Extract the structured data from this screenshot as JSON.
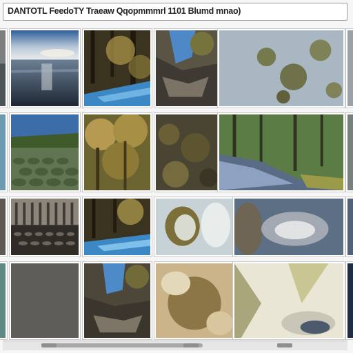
{
  "window": {
    "title": "DANTOTL FeedoTY Traeaw Qqopmmmrl 1101 Blumd mnao)"
  },
  "gallery": {
    "rows": [
      {
        "items": [
          {
            "name": "photo-rocky-shore",
            "kind": "rocks"
          },
          {
            "name": "photo-ocean-sunset",
            "kind": "ocean"
          },
          {
            "name": "photo-forest-stream",
            "kind": "forest-stream"
          },
          {
            "name": "photo-cliff-waterfall",
            "kind": "cliff"
          },
          {
            "name": "photo-lichen-stone",
            "kind": "lichen"
          },
          {
            "name": "photo-edge-right",
            "kind": "edge"
          }
        ]
      },
      {
        "items": [
          {
            "name": "photo-blue-edge",
            "kind": "edge"
          },
          {
            "name": "photo-terraced-hills",
            "kind": "terraces"
          },
          {
            "name": "photo-autumn-woods",
            "kind": "autumn"
          },
          {
            "name": "photo-mossy-ground",
            "kind": "moss"
          },
          {
            "name": "photo-forest-river",
            "kind": "forest-river"
          },
          {
            "name": "photo-edge-right-2",
            "kind": "edge"
          }
        ]
      },
      {
        "items": [
          {
            "name": "photo-dark-edge",
            "kind": "edge"
          },
          {
            "name": "photo-stone-columns",
            "kind": "columns"
          },
          {
            "name": "photo-forest-stream-2",
            "kind": "forest-stream"
          },
          {
            "name": "photo-ice-crystals",
            "kind": "ice"
          },
          {
            "name": "photo-blurred-rock",
            "kind": "blur"
          },
          {
            "name": "photo-edge-right-3",
            "kind": "edge"
          }
        ]
      },
      {
        "items": [
          {
            "name": "photo-teal-edge",
            "kind": "edge"
          },
          {
            "name": "photo-grey-blank",
            "kind": "grey"
          },
          {
            "name": "photo-waterfall-cave",
            "kind": "cliff"
          },
          {
            "name": "photo-glass-texture",
            "kind": "glass"
          },
          {
            "name": "photo-white-petals",
            "kind": "petals"
          },
          {
            "name": "photo-edge-right-4",
            "kind": "edge"
          }
        ]
      }
    ]
  },
  "colors": {
    "frame": "#ffffff",
    "title_text": "#222222",
    "scroll_track": "#e6e6e6",
    "scroll_thumb": "#a7a7a7"
  }
}
